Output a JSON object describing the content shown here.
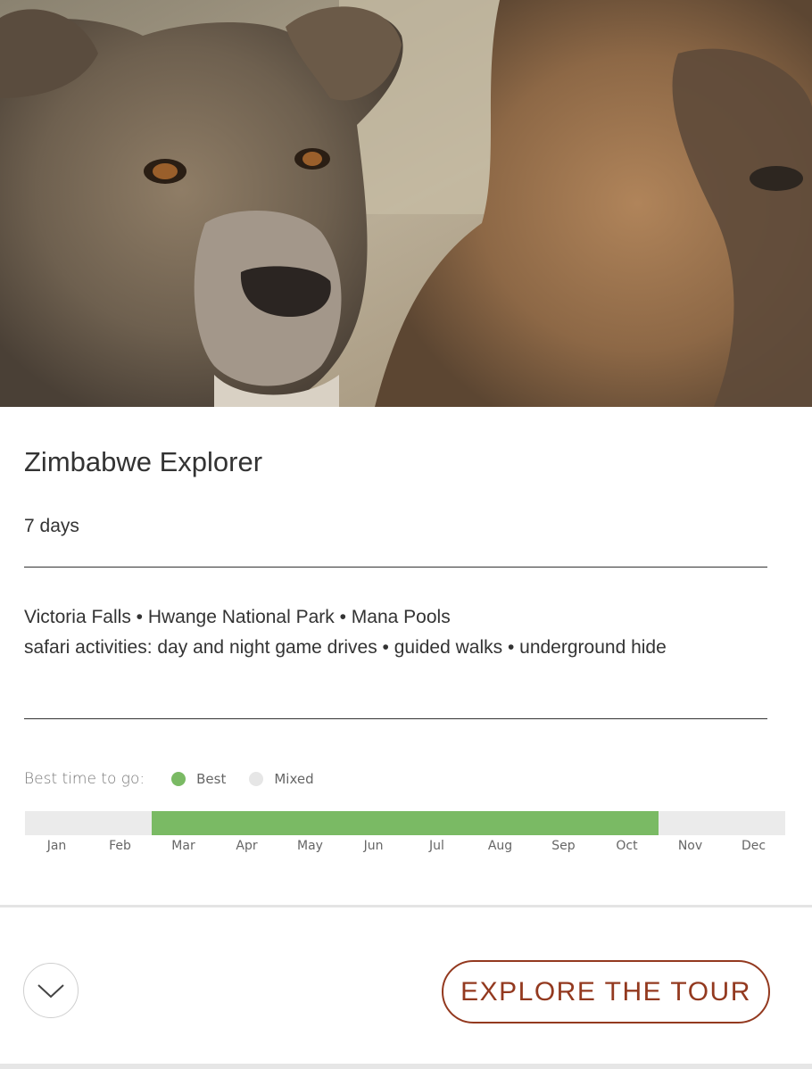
{
  "hero": {
    "image_subject": "lioness and male lion close-up"
  },
  "tour": {
    "title": "Zimbabwe Explorer",
    "duration": "7 days",
    "destinations": "Victoria Falls • Hwange National Park • Mana Pools",
    "activities": "safari activities: day and night game drives • guided walks • underground hide"
  },
  "best_time": {
    "label": "Best time to go:",
    "legend": [
      {
        "label": "Best",
        "color": "#7aba64"
      },
      {
        "label": "Mixed",
        "color": "#e6e6e6"
      }
    ],
    "months": [
      "Jan",
      "Feb",
      "Mar",
      "Apr",
      "May",
      "Jun",
      "Jul",
      "Aug",
      "Sep",
      "Oct",
      "Nov",
      "Dec"
    ],
    "best_range": {
      "start_month": "Mar",
      "end_month": "Oct"
    }
  },
  "footer": {
    "expand_icon": "chevron-down-icon",
    "cta_label": "EXPLORE THE TOUR"
  },
  "colors": {
    "best": "#7aba64",
    "mixed": "#ebebeb",
    "accent": "#93391f"
  }
}
